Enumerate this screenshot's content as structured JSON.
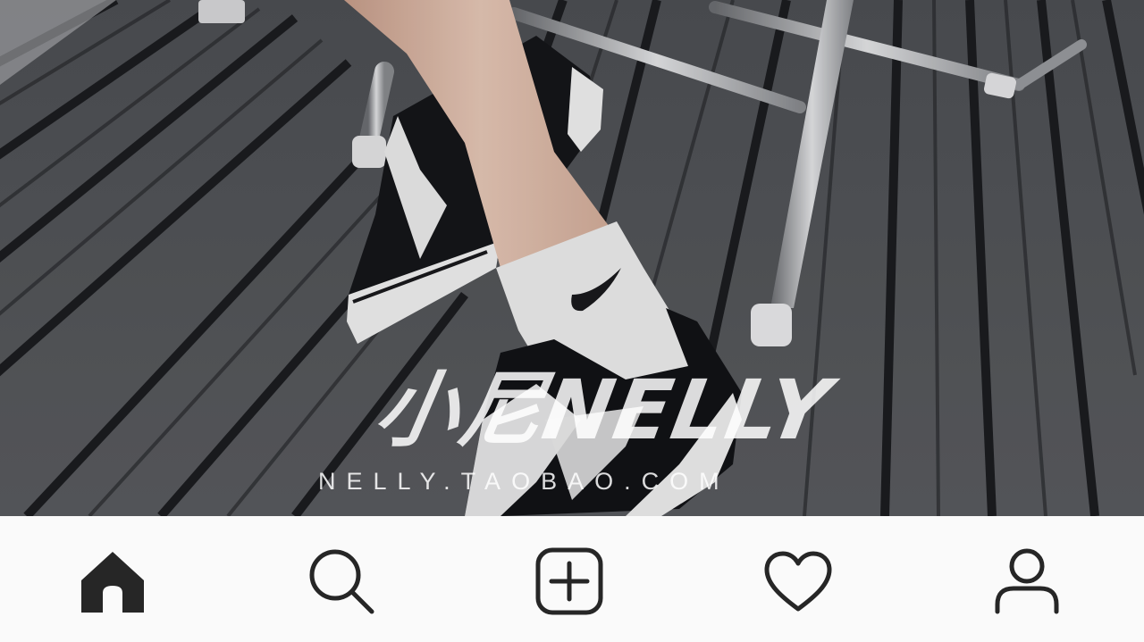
{
  "post": {
    "watermark_logo": "小尼NELLY",
    "watermark_url": "NELLY.TAOBAO.COM"
  },
  "tabbar": {
    "active_tab": "home",
    "icon_color": "#262626",
    "background": "#fafafa",
    "tabs": [
      {
        "id": "home",
        "icon": "home-icon",
        "active": true
      },
      {
        "id": "search",
        "icon": "search-icon",
        "active": false
      },
      {
        "id": "new-post",
        "icon": "add-post-icon",
        "active": false
      },
      {
        "id": "activity",
        "icon": "heart-icon",
        "active": false
      },
      {
        "id": "profile",
        "icon": "profile-icon",
        "active": false
      }
    ]
  }
}
